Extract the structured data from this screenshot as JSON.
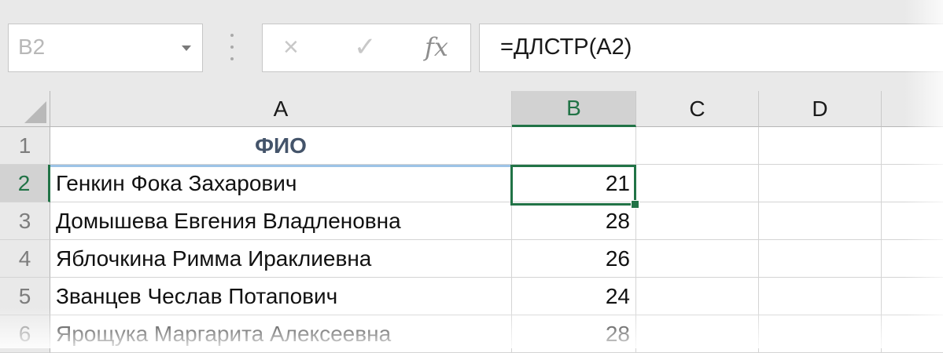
{
  "formula_bar": {
    "name_box": "B2",
    "cancel_icon": "×",
    "enter_icon": "✓",
    "fx_label": "fx",
    "formula": "=ДЛСТР(A2)"
  },
  "columns": [
    "A",
    "B",
    "C",
    "D"
  ],
  "selected": {
    "column": "B",
    "row": "2"
  },
  "rows": [
    {
      "num": "1",
      "a": "ФИО",
      "b": ""
    },
    {
      "num": "2",
      "a": "Генкин Фока Захарович",
      "b": "21"
    },
    {
      "num": "3",
      "a": "Домышева Евгения Владленовна",
      "b": "28"
    },
    {
      "num": "4",
      "a": "Яблочкина Римма Ираклиевна",
      "b": "26"
    },
    {
      "num": "5",
      "a": "Званцев Чеслав Потапович",
      "b": "24"
    },
    {
      "num": "6",
      "a": "Ярощука Маргарита Алексеевна",
      "b": "28"
    }
  ],
  "colors": {
    "accent": "#217346",
    "header_text": "#44546a"
  },
  "icons": {
    "name_box_dropdown": "chevron-down-icon",
    "cancel": "close-icon",
    "enter": "check-icon",
    "insert_function": "function-icon"
  }
}
